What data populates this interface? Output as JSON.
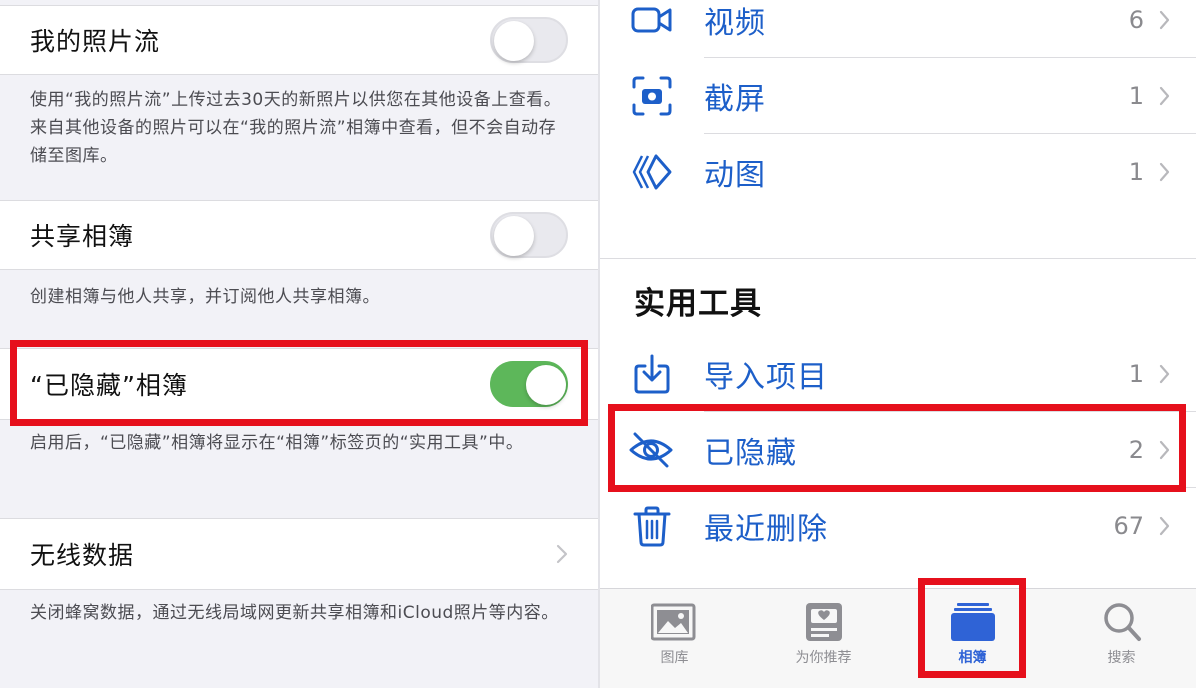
{
  "colors": {
    "accent": "#1d5fc9",
    "toggle_on": "#5db75a",
    "highlight": "#e6101c",
    "tab_active": "#2f63d6"
  },
  "settings": {
    "photo_stream": {
      "label": "我的照片流",
      "toggle_on": false,
      "footer": "使用“我的照片流”上传过去30天的新照片以供您在其他设备上查看。来自其他设备的照片可以在“我的照片流”相簿中查看，但不会自动存储至图库。"
    },
    "shared_albums": {
      "label": "共享相簿",
      "toggle_on": false,
      "footer": "创建相簿与他人共享，并订阅他人共享相簿。"
    },
    "hidden_album": {
      "label": "“已隐藏”相簿",
      "toggle_on": true,
      "footer": "启用后，“已隐藏”相簿将显示在“相簿”标签页的“实用工具”中。"
    },
    "wireless_data": {
      "label": "无线数据",
      "footer": "关闭蜂窝数据，通过无线局域网更新共享相簿和iCloud照片等内容。"
    }
  },
  "albums": {
    "media_types": [
      {
        "label": "视频",
        "count": "6",
        "icon": "video-icon"
      },
      {
        "label": "截屏",
        "count": "1",
        "icon": "screenshot-icon"
      },
      {
        "label": "动图",
        "count": "1",
        "icon": "animated-icon"
      }
    ],
    "utilities_title": "实用工具",
    "utilities": [
      {
        "label": "导入项目",
        "count": "1",
        "icon": "import-icon"
      },
      {
        "label": "已隐藏",
        "count": "2",
        "icon": "hidden-eye-icon"
      },
      {
        "label": "最近删除",
        "count": "67",
        "icon": "trash-icon"
      }
    ]
  },
  "tabbar": {
    "active": "albums",
    "tabs": [
      {
        "label": "图库",
        "icon": "library-icon"
      },
      {
        "label": "为你推荐",
        "icon": "for-you-icon"
      },
      {
        "label": "相簿",
        "icon": "albums-icon"
      },
      {
        "label": "搜索",
        "icon": "search-icon"
      }
    ]
  }
}
